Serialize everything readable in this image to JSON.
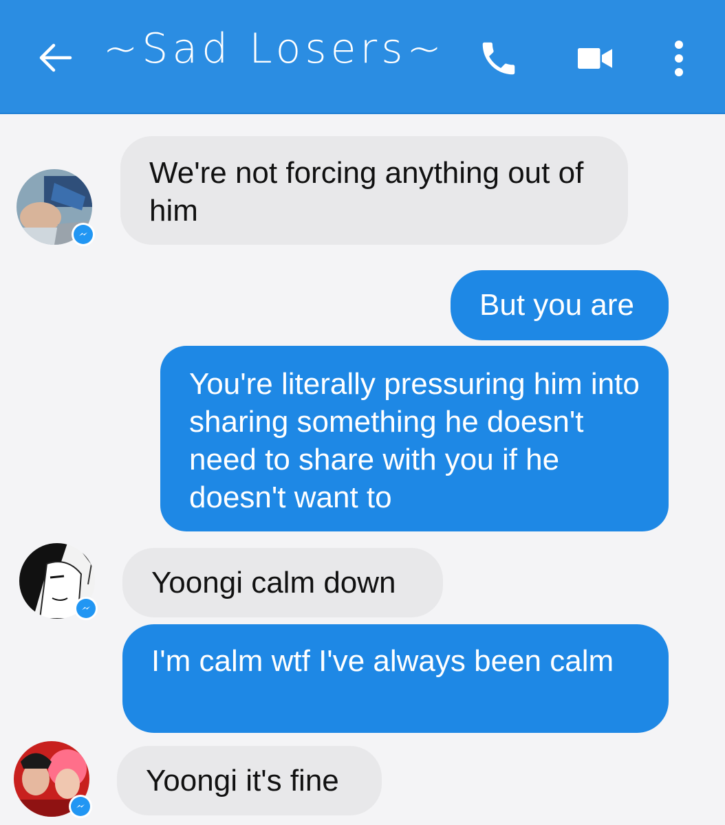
{
  "header": {
    "title": "~Sad Losers~",
    "back_icon": "arrow-left-icon",
    "call_icon": "phone-icon",
    "video_icon": "video-camera-icon",
    "more_icon": "more-vertical-icon",
    "color": "#2b8de2"
  },
  "messages": [
    {
      "direction": "incoming",
      "text": "We're not forcing anything out of him"
    },
    {
      "direction": "outgoing",
      "text": "But you are"
    },
    {
      "direction": "outgoing",
      "text": "You're literally pressuring him into sharing something he doesn't need to share with you if he doesn't want to"
    },
    {
      "direction": "incoming",
      "text": "Yoongi calm down"
    },
    {
      "direction": "outgoing",
      "text": "I'm calm wtf I've always been calm"
    },
    {
      "direction": "incoming",
      "text": "Yoongi it's fine"
    }
  ],
  "colors": {
    "outgoing_bubble": "#1e88e5",
    "incoming_bubble": "#e8e8ea",
    "background": "#f4f4f6"
  }
}
